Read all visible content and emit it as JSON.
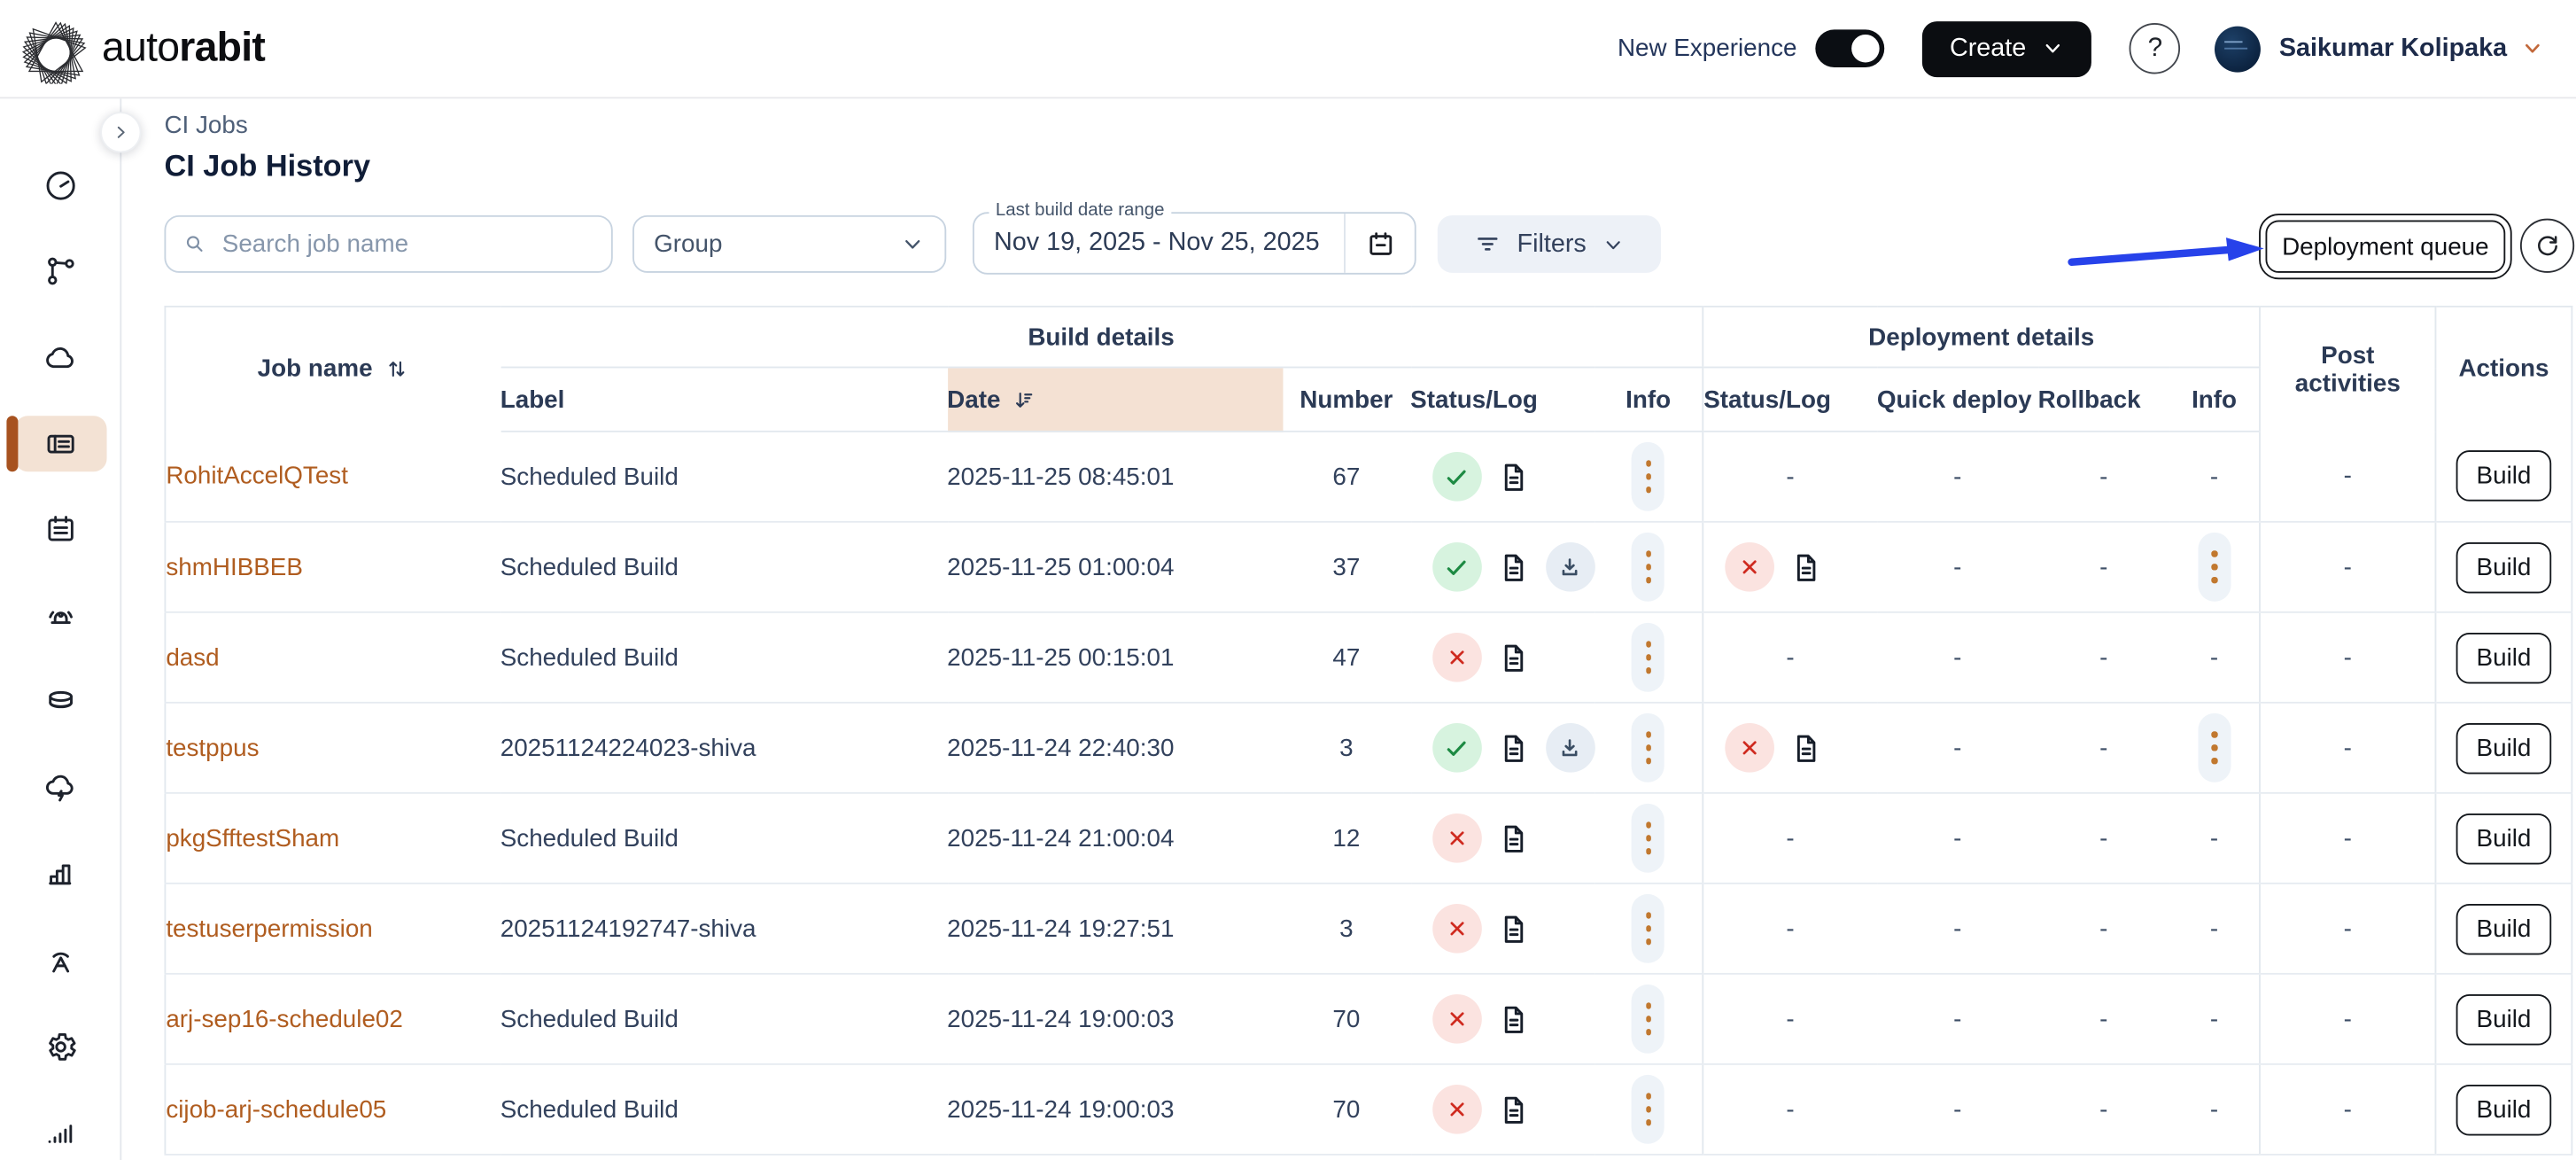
{
  "brand": {
    "name_regular": "auto",
    "name_bold": "rabit"
  },
  "top_bar": {
    "new_experience_label": "New Experience",
    "toggle_state": "on",
    "create_label": "Create",
    "help_label": "?",
    "user_name": "Saikumar Kolipaka"
  },
  "sidebar": {
    "items": [
      {
        "name": "dashboard",
        "active": false
      },
      {
        "name": "version-control",
        "active": false
      },
      {
        "name": "cloud",
        "active": false
      },
      {
        "name": "ci-jobs",
        "active": true
      },
      {
        "name": "calendar",
        "active": false
      },
      {
        "name": "alerts",
        "active": false
      },
      {
        "name": "database",
        "active": false
      },
      {
        "name": "cloud-sync",
        "active": false
      },
      {
        "name": "reports",
        "active": false
      },
      {
        "name": "broadcast",
        "active": false
      },
      {
        "name": "settings",
        "active": false
      },
      {
        "name": "usage",
        "active": false
      }
    ]
  },
  "breadcrumb": {
    "label": "CI Jobs"
  },
  "page": {
    "title": "CI Job History"
  },
  "toolbar": {
    "search_placeholder": "Search job name",
    "group_label": "Group",
    "date_range_label": "Last build date range",
    "date_range_value": "Nov 19, 2025 - Nov 25, 2025",
    "filters_label": "Filters",
    "deployment_queue_label": "Deployment queue"
  },
  "table": {
    "groups": {
      "build": "Build details",
      "deployment": "Deployment details"
    },
    "columns": {
      "job_name": "Job name",
      "label": "Label",
      "date": "Date",
      "number": "Number",
      "status_log": "Status/Log",
      "info": "Info",
      "quick_deploy": "Quick deploy",
      "rollback": "Rollback",
      "post_activities": "Post activities",
      "actions": "Actions"
    },
    "build_button_label": "Build",
    "empty_value": "-",
    "rows": [
      {
        "job_name": "RohitAccelQTest",
        "label": "Scheduled Build",
        "date": "2025-11-25 08:45:01",
        "number": "67",
        "build": {
          "status": "success",
          "log": true,
          "download": false,
          "menu": true
        },
        "deployment": {
          "status": null,
          "log": false,
          "menu": false
        },
        "quick_deploy": "-",
        "rollback": "-",
        "post_activities": "-"
      },
      {
        "job_name": "shmHIBBEB",
        "label": "Scheduled Build",
        "date": "2025-11-25 01:00:04",
        "number": "37",
        "build": {
          "status": "success",
          "log": true,
          "download": true,
          "menu": true
        },
        "deployment": {
          "status": "failed",
          "log": true,
          "menu": true
        },
        "quick_deploy": "-",
        "rollback": "-",
        "post_activities": "-"
      },
      {
        "job_name": "dasd",
        "label": "Scheduled Build",
        "date": "2025-11-25 00:15:01",
        "number": "47",
        "build": {
          "status": "failed",
          "log": true,
          "download": false,
          "menu": true
        },
        "deployment": {
          "status": null,
          "log": false,
          "menu": false
        },
        "quick_deploy": "-",
        "rollback": "-",
        "post_activities": "-"
      },
      {
        "job_name": "testppus",
        "label": "20251124224023-shiva",
        "date": "2025-11-24 22:40:30",
        "number": "3",
        "build": {
          "status": "success",
          "log": true,
          "download": true,
          "menu": true
        },
        "deployment": {
          "status": "failed",
          "log": true,
          "menu": true
        },
        "quick_deploy": "-",
        "rollback": "-",
        "post_activities": "-"
      },
      {
        "job_name": "pkgSfftestSham",
        "label": "Scheduled Build",
        "date": "2025-11-24 21:00:04",
        "number": "12",
        "build": {
          "status": "failed",
          "log": true,
          "download": false,
          "menu": true
        },
        "deployment": {
          "status": null,
          "log": false,
          "menu": false
        },
        "quick_deploy": "-",
        "rollback": "-",
        "post_activities": "-"
      },
      {
        "job_name": "testuserpermission",
        "label": "20251124192747-shiva",
        "date": "2025-11-24 19:27:51",
        "number": "3",
        "build": {
          "status": "failed",
          "log": true,
          "download": false,
          "menu": true
        },
        "deployment": {
          "status": null,
          "log": false,
          "menu": false
        },
        "quick_deploy": "-",
        "rollback": "-",
        "post_activities": "-"
      },
      {
        "job_name": "arj-sep16-schedule02",
        "label": "Scheduled Build",
        "date": "2025-11-24 19:00:03",
        "number": "70",
        "build": {
          "status": "failed",
          "log": true,
          "download": false,
          "menu": true
        },
        "deployment": {
          "status": null,
          "log": false,
          "menu": false
        },
        "quick_deploy": "-",
        "rollback": "-",
        "post_activities": "-"
      },
      {
        "job_name": "cijob-arj-schedule05",
        "label": "Scheduled Build",
        "date": "2025-11-24 19:00:03",
        "number": "70",
        "build": {
          "status": "failed",
          "log": true,
          "download": false,
          "menu": true
        },
        "deployment": {
          "status": null,
          "log": false,
          "menu": false
        },
        "quick_deploy": "-",
        "rollback": "-",
        "post_activities": "-"
      }
    ]
  },
  "colors": {
    "link": "#b05d20",
    "success": "#1d8a43",
    "error": "#cf2a1f",
    "date_header_bg": "#f4e1d3",
    "sidebar_active_bg": "#f3e2d4",
    "sidebar_active_accent": "#a7521f",
    "annotation_arrow": "#2742ea",
    "menu_dots": "#c1782f"
  }
}
